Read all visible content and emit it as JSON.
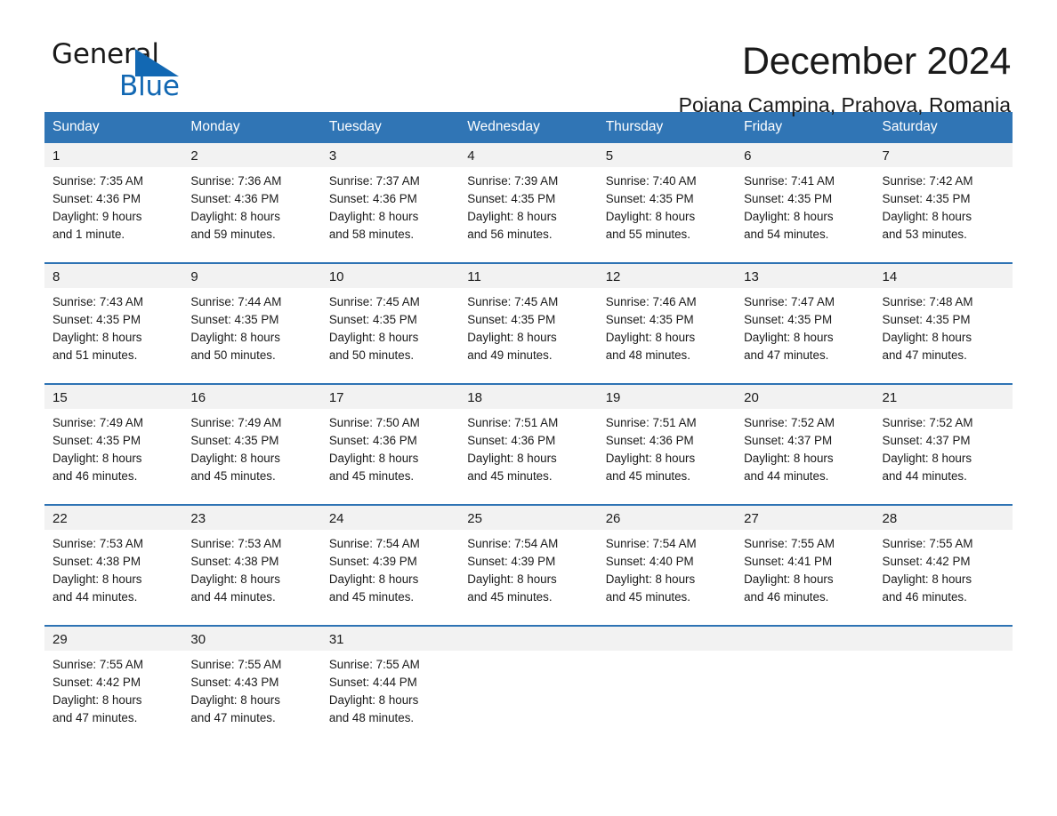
{
  "brand": {
    "name_part1": "General",
    "name_part2": "Blue",
    "triangle_color": "#1268b3",
    "accent_color": "#1268b3"
  },
  "header": {
    "month_title": "December 2024",
    "location": "Poiana Campina, Prahova, Romania"
  },
  "calendar": {
    "header_bg": "#3075b5",
    "header_text_color": "#ffffff",
    "row_separator_color": "#2e73b4",
    "daynum_band_bg": "#f2f2f2",
    "weekday_headers": [
      "Sunday",
      "Monday",
      "Tuesday",
      "Wednesday",
      "Thursday",
      "Friday",
      "Saturday"
    ],
    "weeks": [
      [
        {
          "day": "1",
          "sunrise": "Sunrise: 7:35 AM",
          "sunset": "Sunset: 4:36 PM",
          "daylight_line1": "Daylight: 9 hours",
          "daylight_line2": "and 1 minute."
        },
        {
          "day": "2",
          "sunrise": "Sunrise: 7:36 AM",
          "sunset": "Sunset: 4:36 PM",
          "daylight_line1": "Daylight: 8 hours",
          "daylight_line2": "and 59 minutes."
        },
        {
          "day": "3",
          "sunrise": "Sunrise: 7:37 AM",
          "sunset": "Sunset: 4:36 PM",
          "daylight_line1": "Daylight: 8 hours",
          "daylight_line2": "and 58 minutes."
        },
        {
          "day": "4",
          "sunrise": "Sunrise: 7:39 AM",
          "sunset": "Sunset: 4:35 PM",
          "daylight_line1": "Daylight: 8 hours",
          "daylight_line2": "and 56 minutes."
        },
        {
          "day": "5",
          "sunrise": "Sunrise: 7:40 AM",
          "sunset": "Sunset: 4:35 PM",
          "daylight_line1": "Daylight: 8 hours",
          "daylight_line2": "and 55 minutes."
        },
        {
          "day": "6",
          "sunrise": "Sunrise: 7:41 AM",
          "sunset": "Sunset: 4:35 PM",
          "daylight_line1": "Daylight: 8 hours",
          "daylight_line2": "and 54 minutes."
        },
        {
          "day": "7",
          "sunrise": "Sunrise: 7:42 AM",
          "sunset": "Sunset: 4:35 PM",
          "daylight_line1": "Daylight: 8 hours",
          "daylight_line2": "and 53 minutes."
        }
      ],
      [
        {
          "day": "8",
          "sunrise": "Sunrise: 7:43 AM",
          "sunset": "Sunset: 4:35 PM",
          "daylight_line1": "Daylight: 8 hours",
          "daylight_line2": "and 51 minutes."
        },
        {
          "day": "9",
          "sunrise": "Sunrise: 7:44 AM",
          "sunset": "Sunset: 4:35 PM",
          "daylight_line1": "Daylight: 8 hours",
          "daylight_line2": "and 50 minutes."
        },
        {
          "day": "10",
          "sunrise": "Sunrise: 7:45 AM",
          "sunset": "Sunset: 4:35 PM",
          "daylight_line1": "Daylight: 8 hours",
          "daylight_line2": "and 50 minutes."
        },
        {
          "day": "11",
          "sunrise": "Sunrise: 7:45 AM",
          "sunset": "Sunset: 4:35 PM",
          "daylight_line1": "Daylight: 8 hours",
          "daylight_line2": "and 49 minutes."
        },
        {
          "day": "12",
          "sunrise": "Sunrise: 7:46 AM",
          "sunset": "Sunset: 4:35 PM",
          "daylight_line1": "Daylight: 8 hours",
          "daylight_line2": "and 48 minutes."
        },
        {
          "day": "13",
          "sunrise": "Sunrise: 7:47 AM",
          "sunset": "Sunset: 4:35 PM",
          "daylight_line1": "Daylight: 8 hours",
          "daylight_line2": "and 47 minutes."
        },
        {
          "day": "14",
          "sunrise": "Sunrise: 7:48 AM",
          "sunset": "Sunset: 4:35 PM",
          "daylight_line1": "Daylight: 8 hours",
          "daylight_line2": "and 47 minutes."
        }
      ],
      [
        {
          "day": "15",
          "sunrise": "Sunrise: 7:49 AM",
          "sunset": "Sunset: 4:35 PM",
          "daylight_line1": "Daylight: 8 hours",
          "daylight_line2": "and 46 minutes."
        },
        {
          "day": "16",
          "sunrise": "Sunrise: 7:49 AM",
          "sunset": "Sunset: 4:35 PM",
          "daylight_line1": "Daylight: 8 hours",
          "daylight_line2": "and 45 minutes."
        },
        {
          "day": "17",
          "sunrise": "Sunrise: 7:50 AM",
          "sunset": "Sunset: 4:36 PM",
          "daylight_line1": "Daylight: 8 hours",
          "daylight_line2": "and 45 minutes."
        },
        {
          "day": "18",
          "sunrise": "Sunrise: 7:51 AM",
          "sunset": "Sunset: 4:36 PM",
          "daylight_line1": "Daylight: 8 hours",
          "daylight_line2": "and 45 minutes."
        },
        {
          "day": "19",
          "sunrise": "Sunrise: 7:51 AM",
          "sunset": "Sunset: 4:36 PM",
          "daylight_line1": "Daylight: 8 hours",
          "daylight_line2": "and 45 minutes."
        },
        {
          "day": "20",
          "sunrise": "Sunrise: 7:52 AM",
          "sunset": "Sunset: 4:37 PM",
          "daylight_line1": "Daylight: 8 hours",
          "daylight_line2": "and 44 minutes."
        },
        {
          "day": "21",
          "sunrise": "Sunrise: 7:52 AM",
          "sunset": "Sunset: 4:37 PM",
          "daylight_line1": "Daylight: 8 hours",
          "daylight_line2": "and 44 minutes."
        }
      ],
      [
        {
          "day": "22",
          "sunrise": "Sunrise: 7:53 AM",
          "sunset": "Sunset: 4:38 PM",
          "daylight_line1": "Daylight: 8 hours",
          "daylight_line2": "and 44 minutes."
        },
        {
          "day": "23",
          "sunrise": "Sunrise: 7:53 AM",
          "sunset": "Sunset: 4:38 PM",
          "daylight_line1": "Daylight: 8 hours",
          "daylight_line2": "and 44 minutes."
        },
        {
          "day": "24",
          "sunrise": "Sunrise: 7:54 AM",
          "sunset": "Sunset: 4:39 PM",
          "daylight_line1": "Daylight: 8 hours",
          "daylight_line2": "and 45 minutes."
        },
        {
          "day": "25",
          "sunrise": "Sunrise: 7:54 AM",
          "sunset": "Sunset: 4:39 PM",
          "daylight_line1": "Daylight: 8 hours",
          "daylight_line2": "and 45 minutes."
        },
        {
          "day": "26",
          "sunrise": "Sunrise: 7:54 AM",
          "sunset": "Sunset: 4:40 PM",
          "daylight_line1": "Daylight: 8 hours",
          "daylight_line2": "and 45 minutes."
        },
        {
          "day": "27",
          "sunrise": "Sunrise: 7:55 AM",
          "sunset": "Sunset: 4:41 PM",
          "daylight_line1": "Daylight: 8 hours",
          "daylight_line2": "and 46 minutes."
        },
        {
          "day": "28",
          "sunrise": "Sunrise: 7:55 AM",
          "sunset": "Sunset: 4:42 PM",
          "daylight_line1": "Daylight: 8 hours",
          "daylight_line2": "and 46 minutes."
        }
      ],
      [
        {
          "day": "29",
          "sunrise": "Sunrise: 7:55 AM",
          "sunset": "Sunset: 4:42 PM",
          "daylight_line1": "Daylight: 8 hours",
          "daylight_line2": "and 47 minutes."
        },
        {
          "day": "30",
          "sunrise": "Sunrise: 7:55 AM",
          "sunset": "Sunset: 4:43 PM",
          "daylight_line1": "Daylight: 8 hours",
          "daylight_line2": "and 47 minutes."
        },
        {
          "day": "31",
          "sunrise": "Sunrise: 7:55 AM",
          "sunset": "Sunset: 4:44 PM",
          "daylight_line1": "Daylight: 8 hours",
          "daylight_line2": "and 48 minutes."
        },
        {
          "day": "",
          "sunrise": "",
          "sunset": "",
          "daylight_line1": "",
          "daylight_line2": ""
        },
        {
          "day": "",
          "sunrise": "",
          "sunset": "",
          "daylight_line1": "",
          "daylight_line2": ""
        },
        {
          "day": "",
          "sunrise": "",
          "sunset": "",
          "daylight_line1": "",
          "daylight_line2": ""
        },
        {
          "day": "",
          "sunrise": "",
          "sunset": "",
          "daylight_line1": "",
          "daylight_line2": ""
        }
      ]
    ]
  }
}
